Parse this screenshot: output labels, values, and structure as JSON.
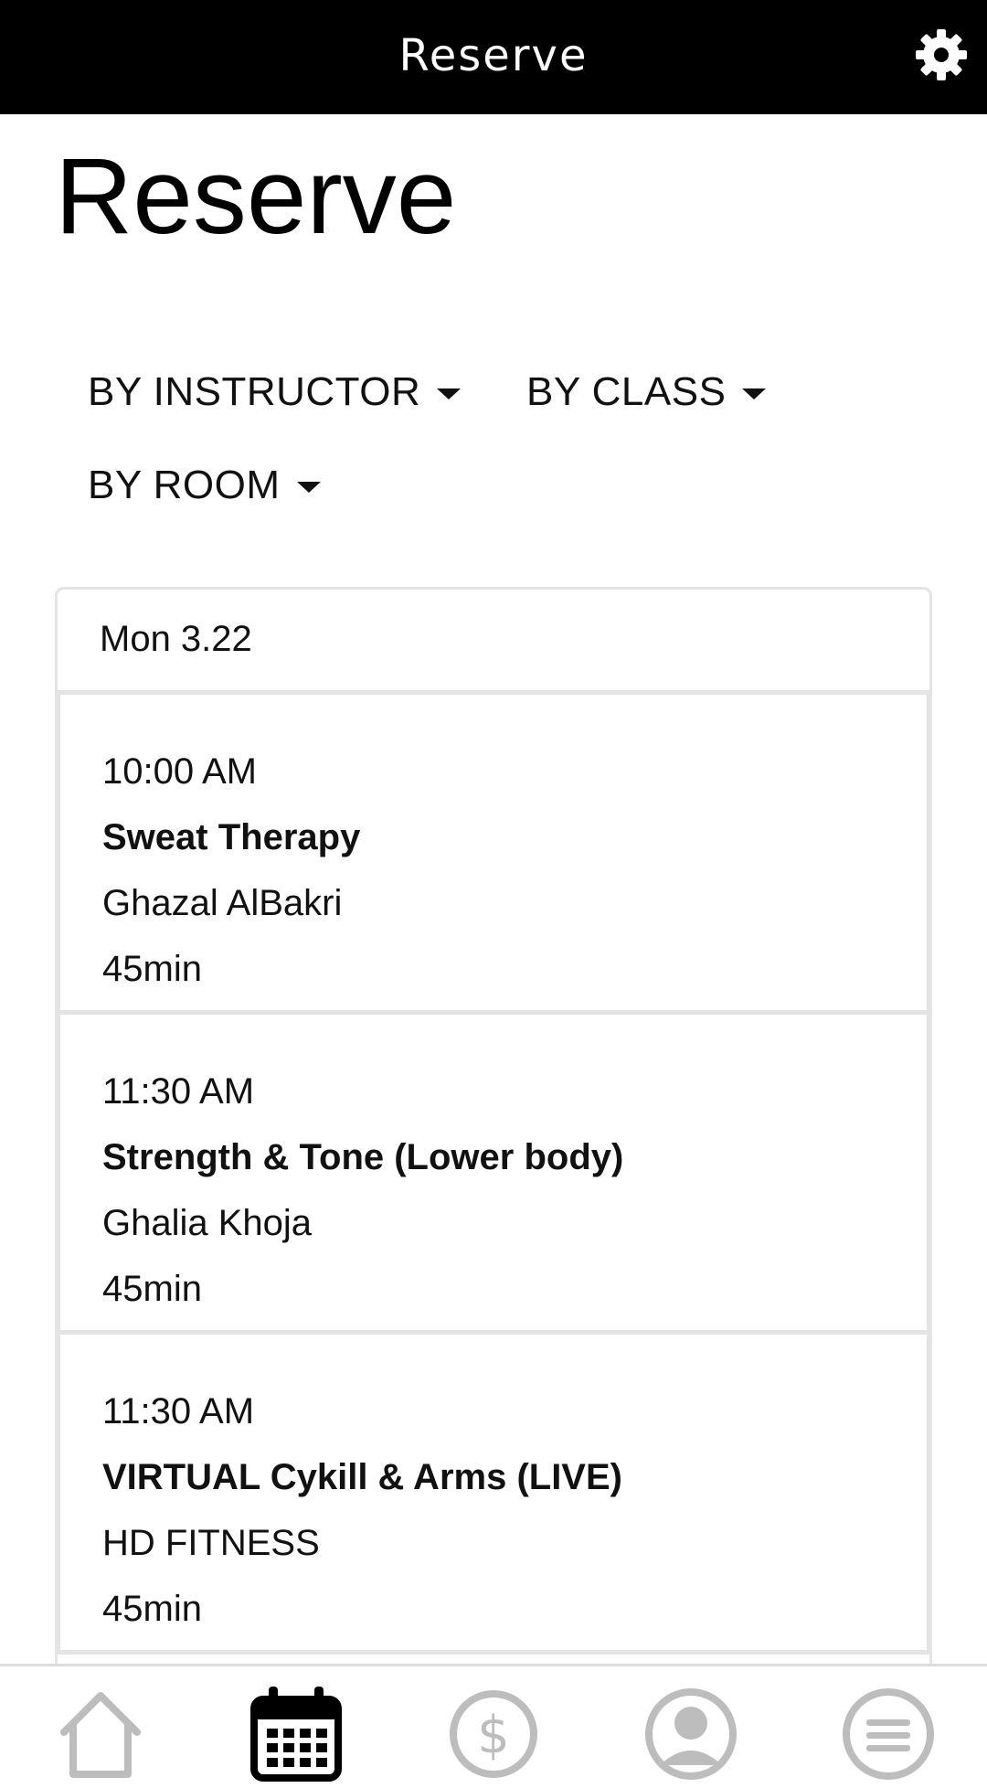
{
  "topbar": {
    "title": "Reserve",
    "settings_icon": "gear-icon"
  },
  "page": {
    "title": "Reserve"
  },
  "filters": [
    {
      "label": "BY INSTRUCTOR"
    },
    {
      "label": "BY CLASS"
    },
    {
      "label": "BY ROOM"
    }
  ],
  "schedule": {
    "day": "Mon 3.22",
    "classes": [
      {
        "time": "10:00 AM",
        "name": "Sweat Therapy",
        "instructor": "Ghazal AlBakri",
        "duration": "45min"
      },
      {
        "time": "11:30 AM",
        "name": "Strength & Tone (Lower body)",
        "instructor": "Ghalia Khoja",
        "duration": "45min"
      },
      {
        "time": "11:30 AM",
        "name": "VIRTUAL Cykill & Arms (LIVE)",
        "instructor": "HD FITNESS",
        "duration": "45min"
      }
    ]
  },
  "bottom_nav": {
    "items": [
      {
        "icon": "home-icon",
        "active": false
      },
      {
        "icon": "calendar-icon",
        "active": true
      },
      {
        "icon": "dollar-icon",
        "active": false
      },
      {
        "icon": "profile-icon",
        "active": false
      },
      {
        "icon": "menu-icon",
        "active": false
      }
    ]
  },
  "colors": {
    "topbar_bg": "#000000",
    "topbar_text": "#ffffff",
    "border": "#e4e4e4",
    "inactive_icon": "#bdbdbd",
    "active_icon": "#000000"
  }
}
